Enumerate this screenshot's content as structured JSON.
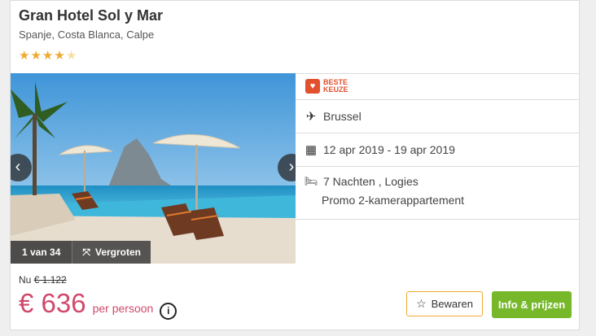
{
  "hotel": {
    "name": "Gran Hotel Sol y Mar",
    "location": "Spanje, Costa Blanca, Calpe",
    "stars": 4,
    "max_stars": 5
  },
  "gallery": {
    "counter": "1 van 34",
    "zoom_label": "Vergroten"
  },
  "details": {
    "badge_line1": "BESTE",
    "badge_line2": "KEUZE",
    "departure": "Brussel",
    "dates": "12 apr 2019 - 19 apr 2019",
    "stay": "7 Nachten , Logies",
    "room": "Promo 2-kamerappartement"
  },
  "pricing": {
    "was_prefix": "Nu",
    "was_price": "€ 1.122",
    "price": "€ 636",
    "per_label": "per persoon"
  },
  "actions": {
    "save_label": "Bewaren",
    "info_label": "Info & prijzen"
  },
  "colors": {
    "price": "#d0486b",
    "primary_button": "#76b82a",
    "star": "#f0a92e",
    "badge": "#e2502e"
  }
}
